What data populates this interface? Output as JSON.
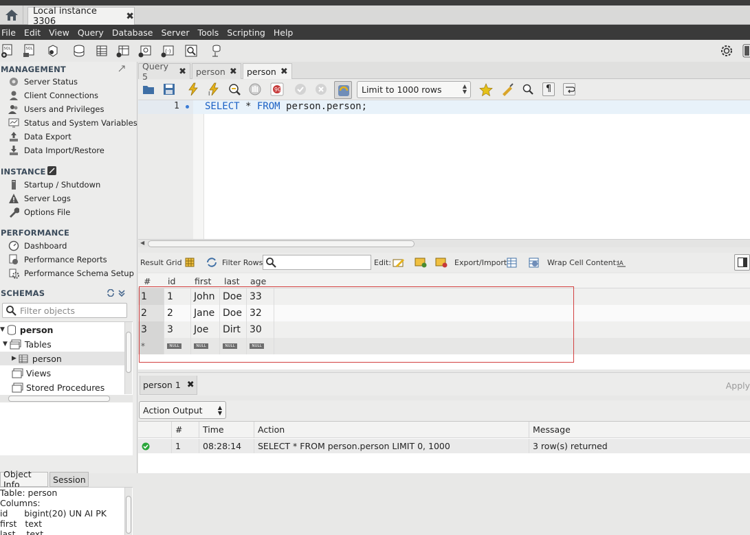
{
  "app": {
    "connection_tab": "Local instance 3306",
    "menu": [
      "File",
      "Edit",
      "View",
      "Query",
      "Database",
      "Server",
      "Tools",
      "Scripting",
      "Help"
    ]
  },
  "sidebar": {
    "management_title": "MANAGEMENT",
    "management_items": [
      "Server Status",
      "Client Connections",
      "Users and Privileges",
      "Status and System Variables",
      "Data Export",
      "Data Import/Restore"
    ],
    "instance_title": "INSTANCE",
    "instance_items": [
      "Startup / Shutdown",
      "Server Logs",
      "Options File"
    ],
    "performance_title": "PERFORMANCE",
    "performance_items": [
      "Dashboard",
      "Performance Reports",
      "Performance Schema Setup"
    ],
    "schemas_title": "SCHEMAS",
    "filter_placeholder": "Filter objects",
    "tree": {
      "schema": "person",
      "tables": "Tables",
      "table": "person",
      "views": "Views",
      "procs": "Stored Procedures"
    },
    "bottom_tabs": [
      "Object Info",
      "Session"
    ],
    "object_info": [
      "Table: person",
      "Columns:",
      "id      bigint(20) UN AI PK",
      "first   text",
      "last    text"
    ]
  },
  "query_tabs": [
    {
      "label": "Query 5"
    },
    {
      "label": "person"
    },
    {
      "label": "person"
    }
  ],
  "query_toolbar": {
    "limit": "Limit to 1000 rows"
  },
  "editor": {
    "line_number": "1",
    "sql_kw1": "SELECT",
    "sql_mid": " * ",
    "sql_kw2": "FROM",
    "sql_rest": " person.person;"
  },
  "result_toolbar": {
    "result_grid": "Result Grid",
    "filter_rows": "Filter Rows:",
    "edit": "Edit:",
    "export_import": "Export/Import:",
    "wrap": "Wrap Cell Content:"
  },
  "grid": {
    "columns": [
      "#",
      "id",
      "first",
      "last",
      "age"
    ],
    "rows": [
      [
        "1",
        "1",
        "John",
        "Doe",
        "33"
      ],
      [
        "2",
        "2",
        "Jane",
        "Doe",
        "32"
      ],
      [
        "3",
        "3",
        "Joe",
        "Dirt",
        "30"
      ]
    ],
    "new_row_marker": "*",
    "null_label": "NULL"
  },
  "result_tab": {
    "label": "person 1",
    "apply": "Apply"
  },
  "output": {
    "selector": "Action Output",
    "columns": [
      "#",
      "Time",
      "Action",
      "Message"
    ],
    "row": {
      "num": "1",
      "time": "08:28:14",
      "action": "SELECT * FROM person.person LIMIT 0, 1000",
      "message": "3 row(s) returned"
    }
  },
  "colors": {
    "accent": "#1a60c4",
    "highlight_border": "#d23f3f",
    "success": "#2aa63a"
  }
}
